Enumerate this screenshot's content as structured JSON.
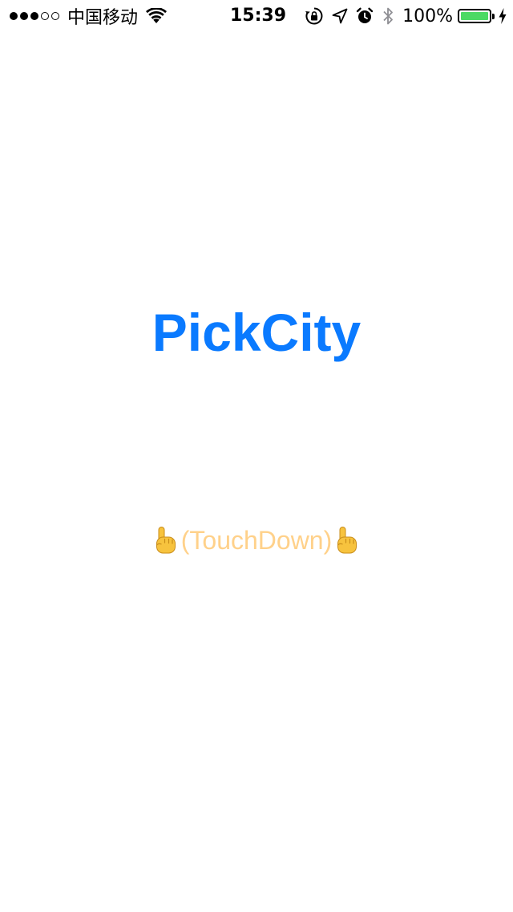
{
  "status_bar": {
    "signal_strength": 3,
    "signal_total": 5,
    "carrier": "中国移动",
    "time": "15:39",
    "battery_percent_text": "100%",
    "battery_level": 1.0,
    "icons": [
      "wifi-icon",
      "orientation-lock-icon",
      "location-arrow-icon",
      "alarm-clock-icon",
      "bluetooth-icon",
      "battery-icon",
      "charging-bolt-icon"
    ]
  },
  "main": {
    "title": "PickCity",
    "touch_label": "(TouchDown)",
    "icons": [
      "pointing-up-hand-icon"
    ]
  },
  "colors": {
    "title": "#0a7aff",
    "touch_label": "#ffd18a",
    "battery_fill": "#4cd964",
    "hand_fill": "#f7c33e"
  }
}
